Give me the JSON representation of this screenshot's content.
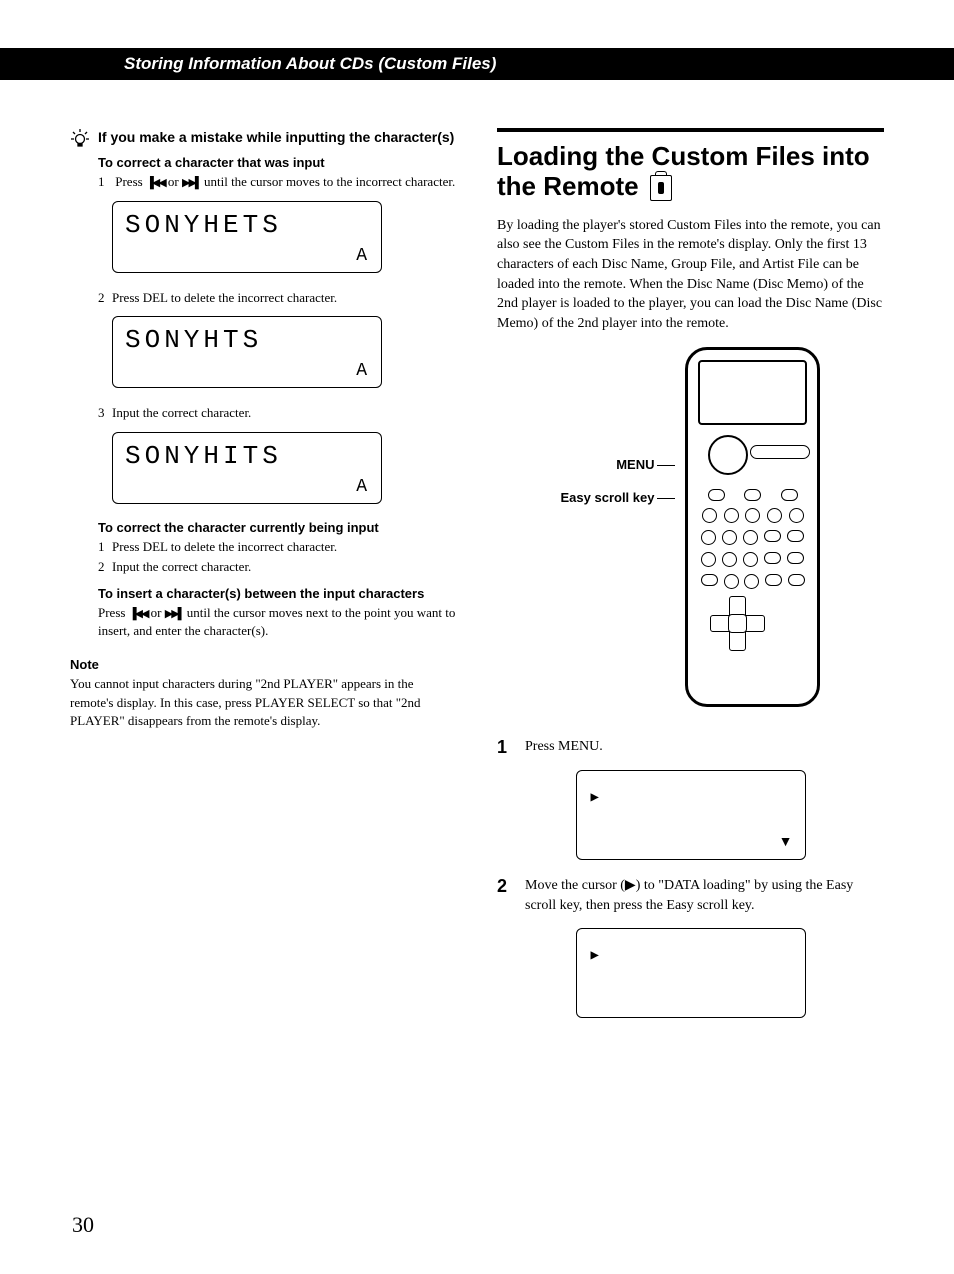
{
  "header": {
    "title": "Storing Information About CDs (Custom Files)"
  },
  "left": {
    "tip_title": "If you make a mistake while inputting the character(s)",
    "correct_input_heading": "To correct a character that was input",
    "step1_num": "1",
    "step1_a": "Press ",
    "step1_b": " or ",
    "step1_c": " until the cursor moves to the incorrect character.",
    "display1": "SONYHETS",
    "display_a": "A",
    "step2_num": "2",
    "step2_text": "Press DEL to delete the incorrect character.",
    "display2": "SONYHTS",
    "step3_num": "3",
    "step3_text": "Input the correct character.",
    "display3": "SONYHITS",
    "correct_current_heading": "To correct the character currently being input",
    "cc_step1_num": "1",
    "cc_step1_text": "Press DEL to delete the incorrect character.",
    "cc_step2_num": "2",
    "cc_step2_text": "Input the correct character.",
    "insert_heading": "To insert a character(s) between the input characters",
    "insert_a": "Press ",
    "insert_b": " or ",
    "insert_c": " until the cursor moves next to the point you want to insert, and enter the character(s).",
    "note_heading": "Note",
    "note_text": "You cannot input characters during \"2nd PLAYER\" appears in the remote's display. In this case, press PLAYER SELECT so that \"2nd PLAYER\" disappears from the remote's display."
  },
  "right": {
    "title": "Loading the Custom Files into the Remote",
    "body": "By loading the player's stored Custom Files into the remote, you can also see the Custom Files in the remote's display. Only the first 13 characters of each Disc Name, Group File, and Artist File can be loaded into the remote. When the Disc Name (Disc Memo) of the 2nd player is loaded to the player, you can load the Disc Name (Disc Memo) of the 2nd player into the remote.",
    "label_menu": "MENU",
    "label_scroll": "Easy scroll key",
    "step1_num": "1",
    "step1_text": "Press MENU.",
    "step2_num": "2",
    "step2_a": "Move the cursor (",
    "step2_b": ") to \"DATA loading\" by using the Easy scroll key, then press the Easy scroll key."
  },
  "icons": {
    "prev": "▐◀◀",
    "next": "▶▶▌",
    "play": "▶",
    "down": "▼",
    "cursor": "▶"
  },
  "page_number": "30"
}
